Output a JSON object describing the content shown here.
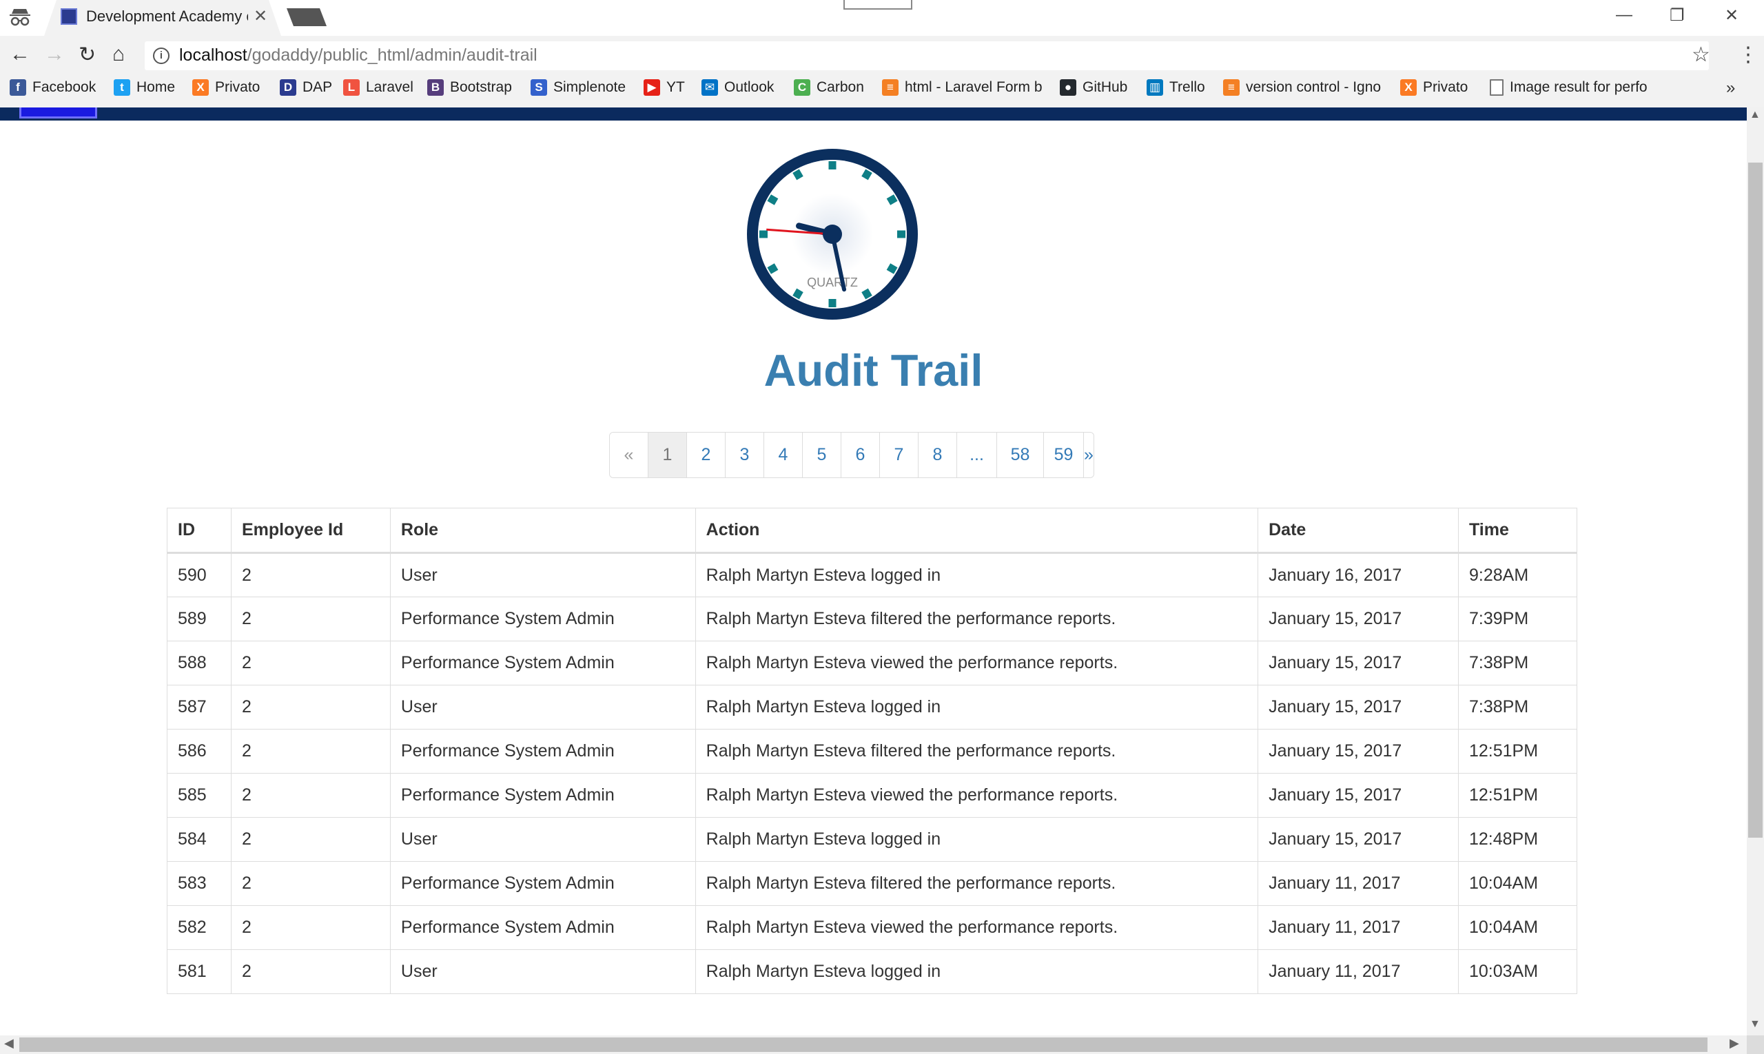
{
  "browser": {
    "tab_title": "Development Academy o",
    "url_host": "localhost",
    "url_path": "/godaddy/public_html/admin/audit-trail"
  },
  "bookmarks": [
    {
      "label": "Facebook",
      "icon": "facebook-icon",
      "color": "#3b5998",
      "glyph": "f"
    },
    {
      "label": "Home",
      "icon": "twitter-icon",
      "color": "#1da1f2",
      "glyph": "t"
    },
    {
      "label": "Privato",
      "icon": "xampp-icon",
      "color": "#fb7a24",
      "glyph": "X"
    },
    {
      "label": "DAP",
      "icon": "dap-icon",
      "color": "#2b3b8f",
      "glyph": "D"
    },
    {
      "label": "Laravel",
      "icon": "laravel-icon",
      "color": "#f05340",
      "glyph": "L"
    },
    {
      "label": "Bootstrap",
      "icon": "bootstrap-icon",
      "color": "#563d7c",
      "glyph": "B"
    },
    {
      "label": "Simplenote",
      "icon": "simplenote-icon",
      "color": "#3361cc",
      "glyph": "S"
    },
    {
      "label": "YT",
      "icon": "youtube-icon",
      "color": "#e62117",
      "glyph": "▶"
    },
    {
      "label": "Outlook",
      "icon": "outlook-icon",
      "color": "#0072c6",
      "glyph": "✉"
    },
    {
      "label": "Carbon",
      "icon": "carbon-icon",
      "color": "#4caf50",
      "glyph": "C"
    },
    {
      "label": "html - Laravel Form b",
      "icon": "stackoverflow-icon",
      "color": "#f48024",
      "glyph": "≡"
    },
    {
      "label": "GitHub",
      "icon": "github-icon",
      "color": "#24292e",
      "glyph": "●"
    },
    {
      "label": "Trello",
      "icon": "trello-icon",
      "color": "#0079bf",
      "glyph": "▥"
    },
    {
      "label": "version control - Igno",
      "icon": "stackoverflow-icon",
      "color": "#f48024",
      "glyph": "≡"
    },
    {
      "label": "Privato",
      "icon": "xampp-icon",
      "color": "#fb7a24",
      "glyph": "X"
    },
    {
      "label": "Image result for perfo",
      "icon": "page-icon",
      "color": "#ffffff",
      "glyph": ""
    }
  ],
  "clock": {
    "brand": "QUARTZ",
    "time": "9:28"
  },
  "page": {
    "title": "Audit Trail"
  },
  "pagination": {
    "prev": "«",
    "pages": [
      "1",
      "2",
      "3",
      "4",
      "5",
      "6",
      "7",
      "8",
      "...",
      "58",
      "59"
    ],
    "active": "1",
    "next": "»"
  },
  "table": {
    "columns": [
      "ID",
      "Employee Id",
      "Role",
      "Action",
      "Date",
      "Time"
    ],
    "rows": [
      [
        "590",
        "2",
        "User",
        "Ralph Martyn Esteva logged in",
        "January 16, 2017",
        "9:28AM"
      ],
      [
        "589",
        "2",
        "Performance System Admin",
        "Ralph Martyn Esteva filtered the performance reports.",
        "January 15, 2017",
        "7:39PM"
      ],
      [
        "588",
        "2",
        "Performance System Admin",
        "Ralph Martyn Esteva viewed the performance reports.",
        "January 15, 2017",
        "7:38PM"
      ],
      [
        "587",
        "2",
        "User",
        "Ralph Martyn Esteva logged in",
        "January 15, 2017",
        "7:38PM"
      ],
      [
        "586",
        "2",
        "Performance System Admin",
        "Ralph Martyn Esteva filtered the performance reports.",
        "January 15, 2017",
        "12:51PM"
      ],
      [
        "585",
        "2",
        "Performance System Admin",
        "Ralph Martyn Esteva viewed the performance reports.",
        "January 15, 2017",
        "12:51PM"
      ],
      [
        "584",
        "2",
        "User",
        "Ralph Martyn Esteva logged in",
        "January 15, 2017",
        "12:48PM"
      ],
      [
        "583",
        "2",
        "Performance System Admin",
        "Ralph Martyn Esteva filtered the performance reports.",
        "January 11, 2017",
        "10:04AM"
      ],
      [
        "582",
        "2",
        "Performance System Admin",
        "Ralph Martyn Esteva viewed the performance reports.",
        "January 11, 2017",
        "10:04AM"
      ],
      [
        "581",
        "2",
        "User",
        "Ralph Martyn Esteva logged in",
        "January 11, 2017",
        "10:03AM"
      ]
    ]
  }
}
